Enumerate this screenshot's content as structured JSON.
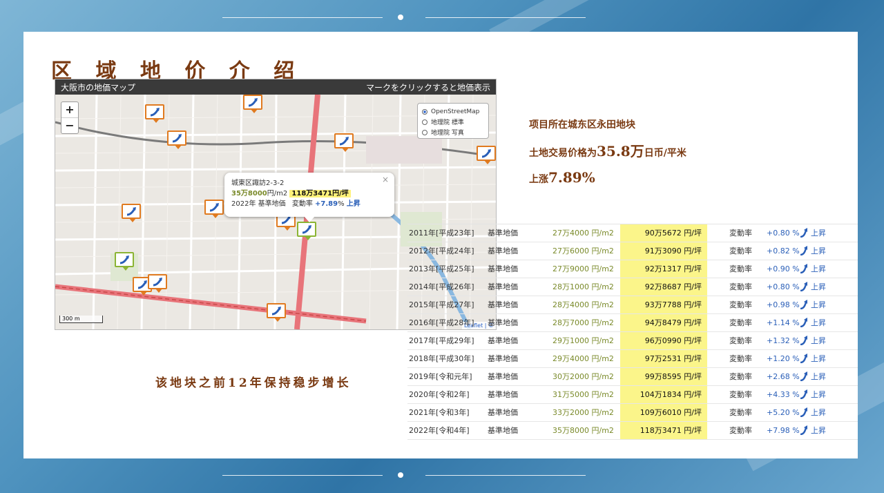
{
  "title": "区 域 地 价 介 绍",
  "map": {
    "header_title": "大阪市の地価マップ",
    "header_hint": "マークをクリックすると地価表示",
    "zoom_in": "+",
    "zoom_out": "−",
    "layers": [
      "OpenStreetMap",
      "地理院 標準",
      "地理院 写真"
    ],
    "selected_layer": "OpenStreetMap",
    "popup": {
      "close": "×",
      "address": "城東区諏訪2-3-2",
      "price_sqm": "35万8000",
      "price_sqm_unit": "円/m2",
      "price_tsubo": "118万3471円/坪",
      "year_type": "2022年 基準地価",
      "rate_label": "変動率",
      "rate": "+7.89",
      "rate_unit": "%",
      "trend": "上昇"
    },
    "scale": "300 m",
    "attribution": "Leaflet | ©",
    "accent_orange": "#e07a1f",
    "accent_green": "#8bb433"
  },
  "info": {
    "line1": "项目所在城东区永田地块",
    "line2_prefix": "土地交易价格为",
    "line2_value": "35.8万",
    "line2_suffix": "日币/平米",
    "line3_prefix": "上涨",
    "line3_value": "7.89%"
  },
  "caption": "该地块之前12年保持稳步增长",
  "table": {
    "rows": [
      {
        "year": "2011年[平成23年]",
        "type": "基準地価",
        "sqm": "27万4000 円/m2",
        "tsubo": "90万5672 円/坪",
        "label": "変動率",
        "rate": "+0.80 %",
        "trend": "上昇"
      },
      {
        "year": "2012年[平成24年]",
        "type": "基準地価",
        "sqm": "27万6000 円/m2",
        "tsubo": "91万3090 円/坪",
        "label": "変動率",
        "rate": "+0.82 %",
        "trend": "上昇"
      },
      {
        "year": "2013年[平成25年]",
        "type": "基準地価",
        "sqm": "27万9000 円/m2",
        "tsubo": "92万1317 円/坪",
        "label": "変動率",
        "rate": "+0.90 %",
        "trend": "上昇"
      },
      {
        "year": "2014年[平成26年]",
        "type": "基準地価",
        "sqm": "28万1000 円/m2",
        "tsubo": "92万8687 円/坪",
        "label": "変動率",
        "rate": "+0.80 %",
        "trend": "上昇"
      },
      {
        "year": "2015年[平成27年]",
        "type": "基準地価",
        "sqm": "28万4000 円/m2",
        "tsubo": "93万7788 円/坪",
        "label": "変動率",
        "rate": "+0.98 %",
        "trend": "上昇"
      },
      {
        "year": "2016年[平成28年]",
        "type": "基準地価",
        "sqm": "28万7000 円/m2",
        "tsubo": "94万8479 円/坪",
        "label": "変動率",
        "rate": "+1.14 %",
        "trend": "上昇"
      },
      {
        "year": "2017年[平成29年]",
        "type": "基準地価",
        "sqm": "29万1000 円/m2",
        "tsubo": "96万0990 円/坪",
        "label": "変動率",
        "rate": "+1.32 %",
        "trend": "上昇"
      },
      {
        "year": "2018年[平成30年]",
        "type": "基準地価",
        "sqm": "29万4000 円/m2",
        "tsubo": "97万2531 円/坪",
        "label": "変動率",
        "rate": "+1.20 %",
        "trend": "上昇"
      },
      {
        "year": "2019年[令和元年]",
        "type": "基準地価",
        "sqm": "30万2000 円/m2",
        "tsubo": "99万8595 円/坪",
        "label": "変動率",
        "rate": "+2.68 %",
        "trend": "上昇"
      },
      {
        "year": "2020年[令和2年]",
        "type": "基準地価",
        "sqm": "31万5000 円/m2",
        "tsubo": "104万1834 円/坪",
        "label": "変動率",
        "rate": "+4.33 %",
        "trend": "上昇"
      },
      {
        "year": "2021年[令和3年]",
        "type": "基準地価",
        "sqm": "33万2000 円/m2",
        "tsubo": "109万6010 円/坪",
        "label": "変動率",
        "rate": "+5.20 %",
        "trend": "上昇"
      },
      {
        "year": "2022年[令和4年]",
        "type": "基準地価",
        "sqm": "35万8000 円/m2",
        "tsubo": "118万3471 円/坪",
        "label": "変動率",
        "rate": "+7.98 %",
        "trend": "上昇"
      }
    ]
  }
}
